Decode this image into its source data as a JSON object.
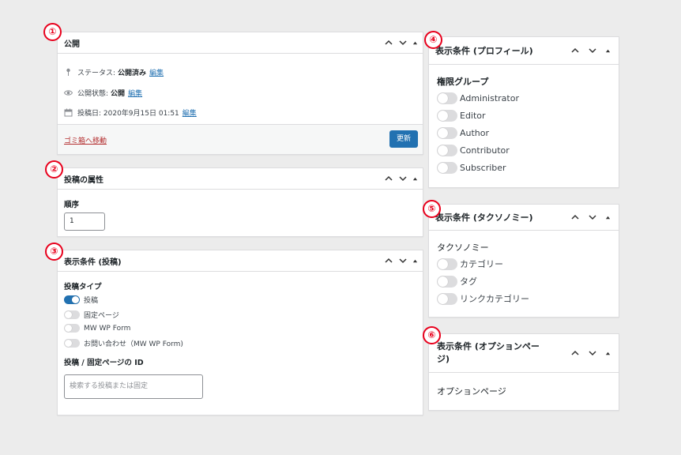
{
  "badges": [
    "①",
    "②",
    "③",
    "④",
    "⑤",
    "⑥"
  ],
  "publish": {
    "title": "公開",
    "status_label": "ステータス:",
    "status_value": "公開済み",
    "status_edit": "編集",
    "visibility_label": "公開状態:",
    "visibility_value": "公開",
    "visibility_edit": "編集",
    "date_label": "投稿日: 2020年9月15日 01:51",
    "date_edit": "編集",
    "trash_link": "ゴミ箱へ移動",
    "update_button": "更新"
  },
  "attributes": {
    "title": "投稿の属性",
    "order_label": "順序",
    "order_value": "1"
  },
  "post_condition": {
    "title": "表示条件 (投稿)",
    "type_label": "投稿タイプ",
    "types": [
      {
        "label": "投稿",
        "on": true
      },
      {
        "label": "固定ページ",
        "on": false
      },
      {
        "label": "MW WP Form",
        "on": false
      },
      {
        "label": "お問い合わせ（MW WP Form)",
        "on": false
      }
    ],
    "id_label": "投稿 / 固定ページの ID",
    "search_placeholder": "検索する投稿または固定"
  },
  "profile_condition": {
    "title": "表示条件 (プロフィール)",
    "group_label": "権限グループ",
    "roles": [
      "Administrator",
      "Editor",
      "Author",
      "Contributor",
      "Subscriber"
    ]
  },
  "taxonomy_condition": {
    "title": "表示条件 (タクソノミー)",
    "group_label": "タクソノミー",
    "items": [
      "カテゴリー",
      "タグ",
      "リンクカテゴリー"
    ]
  },
  "option_condition": {
    "title_line1": "表示条件 (オプションペー",
    "title_line2": "ジ)",
    "label": "オプションページ"
  },
  "colors": {
    "accent": "#2271b1",
    "badge": "#e8001c",
    "trash": "#b32d2e"
  }
}
